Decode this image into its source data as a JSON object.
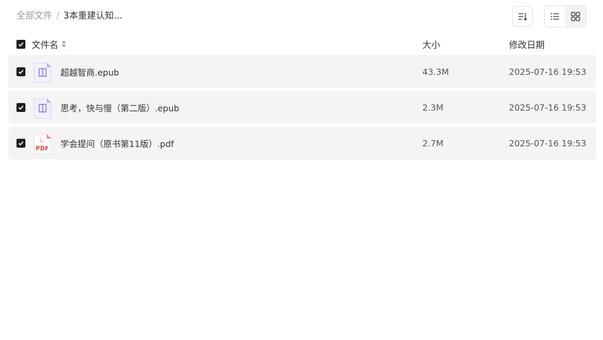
{
  "breadcrumb": {
    "root": "全部文件",
    "separator": "/",
    "current": "3本重建认知..."
  },
  "toolbar": {
    "sort_icon": "sort-descending-icon",
    "view_list_icon": "list-view-icon",
    "view_grid_icon": "grid-view-icon",
    "active_view": "list"
  },
  "table": {
    "columns": {
      "name": "文件名",
      "size": "大小",
      "modified": "修改日期"
    },
    "select_all_checked": true,
    "rows": [
      {
        "name": "超越智商.epub",
        "size": "43.3M",
        "modified": "2025-07-16 19:53",
        "type": "epub",
        "checked": true
      },
      {
        "name": "思考，快与慢（第二版）.epub",
        "size": "2.3M",
        "modified": "2025-07-16 19:53",
        "type": "epub",
        "checked": true
      },
      {
        "name": "学会提问（原书第11版）.pdf",
        "size": "2.7M",
        "modified": "2025-07-16 19:53",
        "type": "pdf",
        "checked": true,
        "icon_label": "PDF"
      }
    ]
  },
  "colors": {
    "row_bg": "#f4f4f4",
    "checkbox": "#1e1e1e",
    "epub_accent": "#7b6fe0",
    "pdf_accent": "#e8453c"
  }
}
